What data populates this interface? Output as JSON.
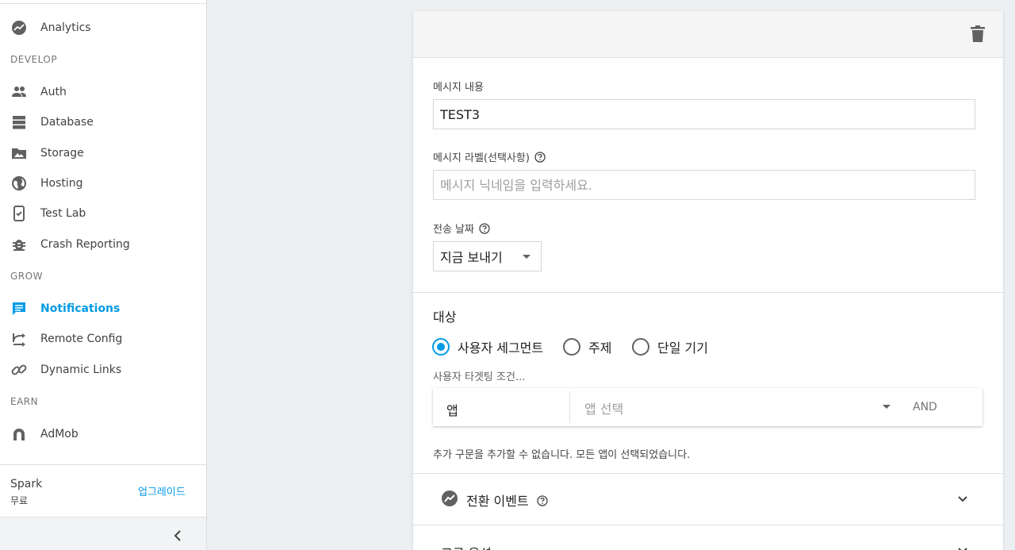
{
  "sidebar": {
    "items": [
      {
        "label": "Analytics",
        "icon": "analytics-icon"
      },
      {
        "label": "Auth",
        "icon": "auth-icon"
      },
      {
        "label": "Database",
        "icon": "database-icon"
      },
      {
        "label": "Storage",
        "icon": "storage-icon"
      },
      {
        "label": "Hosting",
        "icon": "hosting-icon"
      },
      {
        "label": "Test Lab",
        "icon": "test-lab-icon"
      },
      {
        "label": "Crash Reporting",
        "icon": "crash-reporting-icon"
      },
      {
        "label": "Notifications",
        "icon": "notifications-icon"
      },
      {
        "label": "Remote Config",
        "icon": "remote-config-icon"
      },
      {
        "label": "Dynamic Links",
        "icon": "dynamic-links-icon"
      },
      {
        "label": "AdMob",
        "icon": "admob-icon"
      }
    ],
    "sections": {
      "develop": "DEVELOP",
      "grow": "GROW",
      "earn": "EARN"
    },
    "active_item": "Notifications",
    "plan": {
      "name": "Spark",
      "price": "무료",
      "upgrade_label": "업그레이드"
    }
  },
  "form": {
    "message_text_label": "메시지 내용",
    "message_text_value": "TEST3",
    "message_label_label": "메시지 라벨(선택사항)",
    "message_label_placeholder": "메시지 닉네임을 입력하세요.",
    "delivery_date_label": "전송 날짜",
    "delivery_date_value": "지금 보내기",
    "target_title": "대상",
    "target_options": [
      {
        "label": "사용자 세그먼트",
        "checked": true
      },
      {
        "label": "주제",
        "checked": false
      },
      {
        "label": "단일 기기",
        "checked": false
      }
    ],
    "targeting_label": "사용자 타겟팅 조건...",
    "condition": {
      "app_label": "앱",
      "select_placeholder": "앱 선택",
      "and_label": "AND"
    },
    "condition_note": "추가 구문을 추가할 수 없습니다. 모든 앱이 선택되었습니다.",
    "conversion_events_label": "전환 이벤트",
    "advanced_options_label": "고급 옵션"
  },
  "colors": {
    "accent": "#039be5",
    "text": "#212121",
    "background": "#eceff1"
  }
}
